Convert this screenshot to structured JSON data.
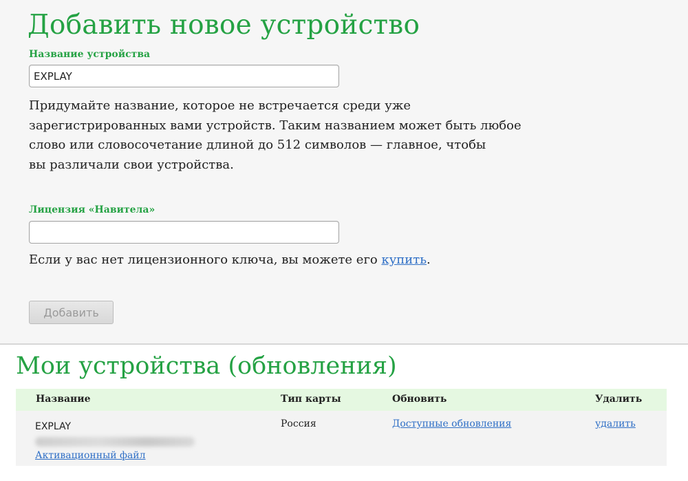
{
  "add_device": {
    "title": "Добавить новое устройство",
    "name_label": "Название устройства",
    "name_value": "EXPLAY",
    "name_hint_lines": [
      "Придумайте название, которое не встречается среди уже",
      "зарегистрированных вами устройств. Таким названием может быть любое",
      "слово или словосочетание длиной до 512 символов — главное, чтобы",
      "вы различали свои устройства."
    ],
    "license_label": "Лицензия «Навитела»",
    "license_value": "",
    "license_hint_prefix": "Если у вас нет лицензионного ключа, вы можете его ",
    "license_hint_link": "купить",
    "license_hint_suffix": ".",
    "add_button": "Добавить"
  },
  "my_devices": {
    "title": "Мои устройства (обновления)",
    "columns": {
      "name": "Название",
      "map_type": "Тип карты",
      "update": "Обновить",
      "delete": "Удалить"
    },
    "rows": [
      {
        "name": "EXPLAY",
        "activation_link": "Активационный файл",
        "map_type": "Россия",
        "update_link": "Доступные обновления",
        "delete_link": "удалить"
      }
    ]
  },
  "colors": {
    "heading_green": "#25a244",
    "link_blue": "#2f6fc6",
    "table_header_bg": "#e5f8e1",
    "form_bg": "#f6f6f6"
  }
}
